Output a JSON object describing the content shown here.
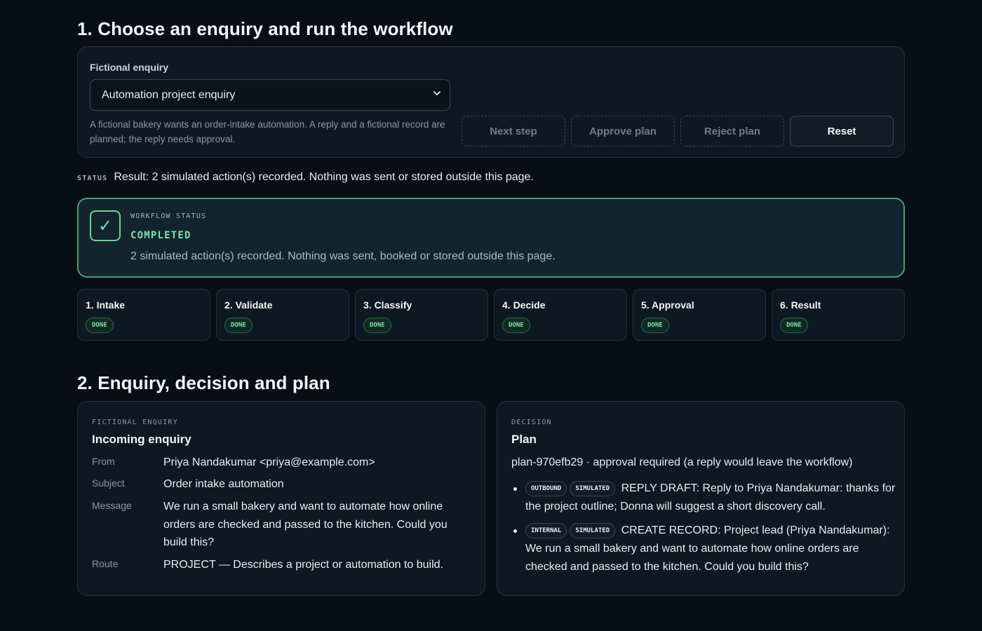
{
  "section1": {
    "title": "1. Choose an enquiry and run the workflow",
    "enquiry_label": "Fictional enquiry",
    "selected_enquiry": "Automation project enquiry",
    "description": "A fictional bakery wants an order-intake automation. A reply and a fictional record are planned; the reply needs approval.",
    "buttons": {
      "next": "Next step",
      "approve": "Approve plan",
      "reject": "Reject plan",
      "reset": "Reset"
    }
  },
  "status": {
    "key": "STATUS",
    "text": "Result: 2 simulated action(s) recorded. Nothing was sent or stored outside this page."
  },
  "workflow": {
    "key": "WORKFLOW STATUS",
    "state": "COMPLETED",
    "message": "2 simulated action(s) recorded. Nothing was sent, booked or stored outside this page.",
    "check": "✓"
  },
  "steps": [
    {
      "label": "1. Intake",
      "badge": "DONE"
    },
    {
      "label": "2. Validate",
      "badge": "DONE"
    },
    {
      "label": "3. Classify",
      "badge": "DONE"
    },
    {
      "label": "4. Decide",
      "badge": "DONE"
    },
    {
      "label": "5. Approval",
      "badge": "DONE"
    },
    {
      "label": "6. Result",
      "badge": "DONE"
    }
  ],
  "section2": {
    "title": "2. Enquiry, decision and plan"
  },
  "enquiry": {
    "key": "FICTIONAL ENQUIRY",
    "title": "Incoming enquiry",
    "from_label": "From",
    "from": "Priya Nandakumar <priya@example.com>",
    "subject_label": "Subject",
    "subject": "Order intake automation",
    "message_label": "Message",
    "message": "We run a small bakery and want to automate how online orders are checked and passed to the kitchen. Could you build this?",
    "route_label": "Route",
    "route": "PROJECT — Describes a project or automation to build."
  },
  "decision": {
    "key": "DECISION",
    "title": "Plan",
    "plan_line": "plan-970efb29 · approval required (a reply would leave the workflow)",
    "items": [
      {
        "tag1": "OUTBOUND",
        "tag2": "SIMULATED",
        "text": "REPLY DRAFT: Reply to Priya Nandakumar: thanks for the project outline; Donna will suggest a short discovery call."
      },
      {
        "tag1": "INTERNAL",
        "tag2": "SIMULATED",
        "text": "CREATE RECORD: Project lead (Priya Nandakumar): We run a small bakery and want to automate how online orders are checked and passed to the kitchen. Could you build this?"
      }
    ]
  },
  "colors": {
    "background": "#080e16",
    "accent_green": "#7ee2a8",
    "panel": "#0e1822"
  }
}
